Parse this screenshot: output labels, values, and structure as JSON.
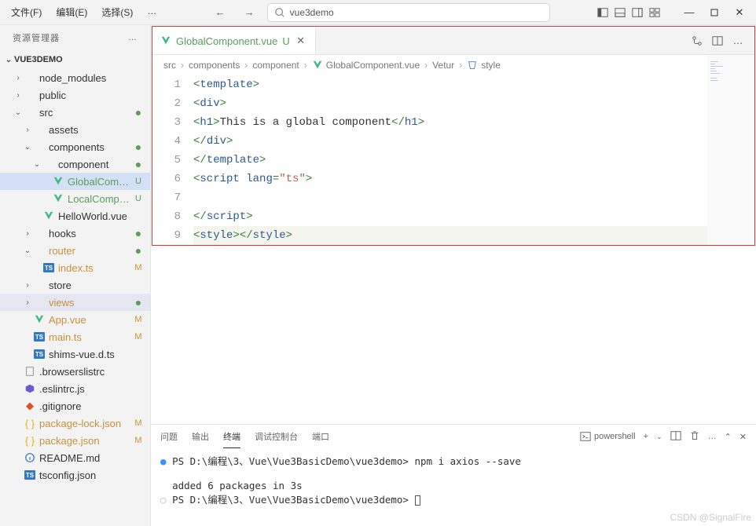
{
  "menu": {
    "file": "文件(F)",
    "edit": "编辑(E)",
    "select": "选择(S)",
    "more": "…"
  },
  "search": {
    "text": "vue3demo"
  },
  "sidebar": {
    "title": "资源管理器",
    "project": "VUE3DEMO",
    "tree": [
      {
        "label": "node_modules",
        "indent": 1,
        "chevron": "›",
        "icon": "folder"
      },
      {
        "label": "public",
        "indent": 1,
        "chevron": "›",
        "icon": "folder"
      },
      {
        "label": "src",
        "indent": 1,
        "chevron": "⌄",
        "icon": "folder",
        "status": "●",
        "statusClass": "git-dot"
      },
      {
        "label": "assets",
        "indent": 2,
        "chevron": "›",
        "icon": "folder"
      },
      {
        "label": "components",
        "indent": 2,
        "chevron": "⌄",
        "icon": "folder",
        "status": "●",
        "statusClass": "git-dot"
      },
      {
        "label": "component",
        "indent": 3,
        "chevron": "⌄",
        "icon": "folder",
        "status": "●",
        "statusClass": "git-dot"
      },
      {
        "label": "GlobalComp...",
        "indent": 4,
        "icon": "vue",
        "status": "U",
        "statusClass": "git-U",
        "labelClass": "untracked-text",
        "active": true
      },
      {
        "label": "LocalCompo...",
        "indent": 4,
        "icon": "vue",
        "status": "U",
        "statusClass": "git-U",
        "labelClass": "untracked-text"
      },
      {
        "label": "HelloWorld.vue",
        "indent": 3,
        "icon": "vue"
      },
      {
        "label": "hooks",
        "indent": 2,
        "chevron": "›",
        "icon": "folder",
        "status": "●",
        "statusClass": "git-dot"
      },
      {
        "label": "router",
        "indent": 2,
        "chevron": "⌄",
        "icon": "folder",
        "status": "●",
        "statusClass": "git-dot",
        "labelClass": "mod-text"
      },
      {
        "label": "index.ts",
        "indent": 3,
        "icon": "ts",
        "status": "M",
        "statusClass": "git-M",
        "labelClass": "mod-text"
      },
      {
        "label": "store",
        "indent": 2,
        "chevron": "›",
        "icon": "folder"
      },
      {
        "label": "views",
        "indent": 2,
        "chevron": "›",
        "icon": "folder",
        "status": "●",
        "statusClass": "git-dot",
        "labelClass": "mod-text",
        "highlight": true
      },
      {
        "label": "App.vue",
        "indent": 2,
        "icon": "vue",
        "status": "M",
        "statusClass": "git-M",
        "labelClass": "mod-text"
      },
      {
        "label": "main.ts",
        "indent": 2,
        "icon": "ts",
        "status": "M",
        "statusClass": "git-M",
        "labelClass": "mod-text"
      },
      {
        "label": "shims-vue.d.ts",
        "indent": 2,
        "icon": "ts"
      },
      {
        "label": ".browserslistrc",
        "indent": 1,
        "icon": "file"
      },
      {
        "label": ".eslintrc.js",
        "indent": 1,
        "icon": "eslint"
      },
      {
        "label": ".gitignore",
        "indent": 1,
        "icon": "git"
      },
      {
        "label": "package-lock.json",
        "indent": 1,
        "icon": "json",
        "status": "M",
        "statusClass": "git-M",
        "labelClass": "mod-text"
      },
      {
        "label": "package.json",
        "indent": 1,
        "icon": "json",
        "status": "M",
        "statusClass": "git-M",
        "labelClass": "mod-text"
      },
      {
        "label": "README.md",
        "indent": 1,
        "icon": "md"
      },
      {
        "label": "tsconfig.json",
        "indent": 1,
        "icon": "tsjson"
      }
    ]
  },
  "tab": {
    "name": "GlobalComponent.vue",
    "status": "U"
  },
  "breadcrumb": [
    "src",
    "components",
    "component",
    "GlobalComponent.vue",
    "Vetur",
    "style"
  ],
  "code": {
    "lines": [
      {
        "n": 1,
        "tokens": [
          {
            "t": "<",
            "c": "tok-tag"
          },
          {
            "t": "template",
            "c": "tok-name"
          },
          {
            "t": ">",
            "c": "tok-tag"
          }
        ]
      },
      {
        "n": 2,
        "tokens": [
          {
            "t": "    ",
            "c": ""
          },
          {
            "t": "<",
            "c": "tok-tag"
          },
          {
            "t": "div",
            "c": "tok-name"
          },
          {
            "t": ">",
            "c": "tok-tag"
          }
        ]
      },
      {
        "n": 3,
        "tokens": [
          {
            "t": "        ",
            "c": ""
          },
          {
            "t": "<",
            "c": "tok-tag"
          },
          {
            "t": "h1",
            "c": "tok-name"
          },
          {
            "t": ">",
            "c": "tok-tag"
          },
          {
            "t": "This is a global component",
            "c": "tok-text"
          },
          {
            "t": "</",
            "c": "tok-tag"
          },
          {
            "t": "h1",
            "c": "tok-name"
          },
          {
            "t": ">",
            "c": "tok-tag"
          }
        ]
      },
      {
        "n": 4,
        "tokens": [
          {
            "t": "    ",
            "c": ""
          },
          {
            "t": "</",
            "c": "tok-tag"
          },
          {
            "t": "div",
            "c": "tok-name"
          },
          {
            "t": ">",
            "c": "tok-tag"
          }
        ]
      },
      {
        "n": 5,
        "tokens": [
          {
            "t": "</",
            "c": "tok-tag"
          },
          {
            "t": "template",
            "c": "tok-name"
          },
          {
            "t": ">",
            "c": "tok-tag"
          }
        ]
      },
      {
        "n": 6,
        "tokens": [
          {
            "t": "<",
            "c": "tok-tag"
          },
          {
            "t": "script",
            "c": "tok-name"
          },
          {
            "t": " ",
            "c": ""
          },
          {
            "t": "lang",
            "c": "tok-attr"
          },
          {
            "t": "=",
            "c": "tok-tag"
          },
          {
            "t": "\"ts\"",
            "c": "tok-str"
          },
          {
            "t": ">",
            "c": "tok-tag"
          }
        ]
      },
      {
        "n": 7,
        "tokens": []
      },
      {
        "n": 8,
        "tokens": [
          {
            "t": "</",
            "c": "tok-tag"
          },
          {
            "t": "script",
            "c": "tok-name"
          },
          {
            "t": ">",
            "c": "tok-tag"
          }
        ]
      },
      {
        "n": 9,
        "current": true,
        "tokens": [
          {
            "t": "<",
            "c": "tok-tag"
          },
          {
            "t": "style",
            "c": "tok-name"
          },
          {
            "t": ">",
            "c": "tok-tag"
          },
          {
            "t": "</",
            "c": "tok-tag"
          },
          {
            "t": "style",
            "c": "tok-name"
          },
          {
            "t": ">",
            "c": "tok-tag"
          }
        ]
      }
    ]
  },
  "panel": {
    "tabs": {
      "problems": "问题",
      "output": "输出",
      "terminal": "终端",
      "debug": "调试控制台",
      "ports": "端口"
    },
    "shell": "powershell"
  },
  "terminal": {
    "line1_path": "PS D:\\编程\\3、Vue\\Vue3BasicDemo\\vue3demo>",
    "line1_cmd": " npm i axios --save",
    "line2": "added 6 packages in 3s",
    "line3_path": "PS D:\\编程\\3、Vue\\Vue3BasicDemo\\vue3demo>"
  },
  "watermark": "CSDN @SignalFire"
}
